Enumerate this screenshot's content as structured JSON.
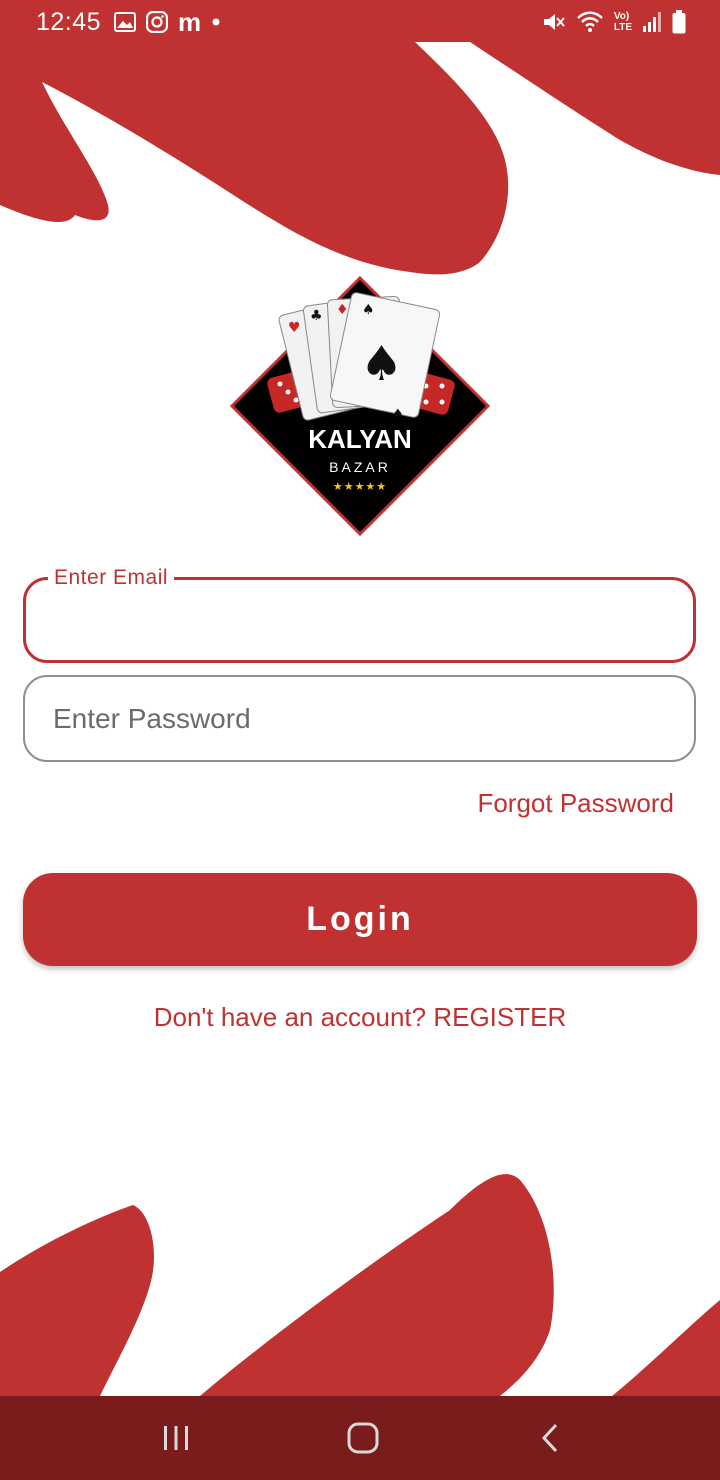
{
  "status_bar": {
    "time": "12:45",
    "left_icons": [
      "image-icon",
      "instagram-icon",
      "m-app-icon",
      "dot-icon"
    ],
    "right_icons": [
      "mute-icon",
      "wifi-icon",
      "volte-icon",
      "signal-icon",
      "battery-icon"
    ],
    "volte_top": "Vo)",
    "volte_bottom": "LTE",
    "m_app_letter": "m"
  },
  "logo": {
    "title": "KALYAN",
    "subtitle": "BAZAR",
    "stars": "★★★★★"
  },
  "form": {
    "email_label": "Enter Email",
    "email_value": "",
    "password_placeholder": "Enter Password",
    "password_value": "",
    "forgot_label": "Forgot Password",
    "login_label": "Login",
    "register_text": "Don't have an account? REGISTER"
  },
  "nav_bar": {
    "buttons": [
      "recents-icon",
      "home-icon",
      "back-icon"
    ]
  },
  "colors": {
    "accent": "#c03232",
    "nav_bar": "#7a1c1c",
    "input_border": "#8f8f8f"
  }
}
